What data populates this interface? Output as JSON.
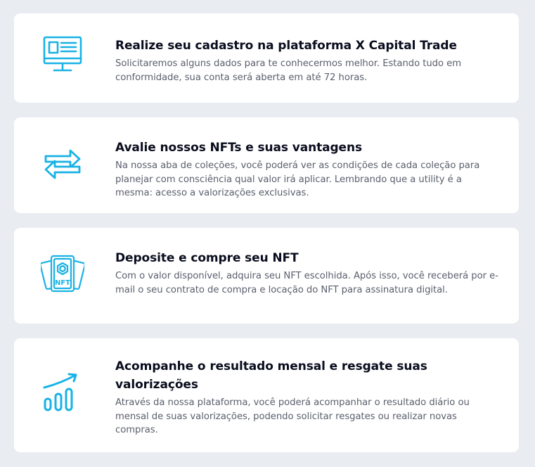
{
  "steps": [
    {
      "icon": "monitor-document-icon",
      "title": "Realize seu cadastro na plataforma X Capital Trade",
      "description": "Solicitaremos alguns dados para te conhecermos melhor. Estando tudo em conformidade, sua conta será aberta em até 72 horas."
    },
    {
      "icon": "exchange-arrows-icon",
      "title": "Avalie nossos NFTs e suas vantagens",
      "description": "Na nossa aba de coleções, você poderá ver as condições de cada coleção para planejar com consciência qual valor irá aplicar. Lembrando que a utility é a mesma: acesso a valorizações exclusivas."
    },
    {
      "icon": "nft-cards-icon",
      "icon_label": "NFT",
      "title": "Deposite e compre seu NFT",
      "description": "Com o valor disponível, adquira seu NFT escolhida. Após isso, você receberá por e-mail o seu contrato de compra e locação do NFT para assinatura digital."
    },
    {
      "icon": "growth-chart-icon",
      "title": "Acompanhe o resultado mensal e resgate suas valorizações",
      "description": "Através da nossa plataforma, você poderá acompanhar o resultado diário ou mensal de suas valorizações, podendo solicitar resgates ou realizar novas compras."
    }
  ],
  "colors": {
    "background": "#e9edf1",
    "card": "#ffffff",
    "accent": "#18b2e4",
    "title": "#0a0d1e",
    "body_text": "#5b5f6d"
  }
}
